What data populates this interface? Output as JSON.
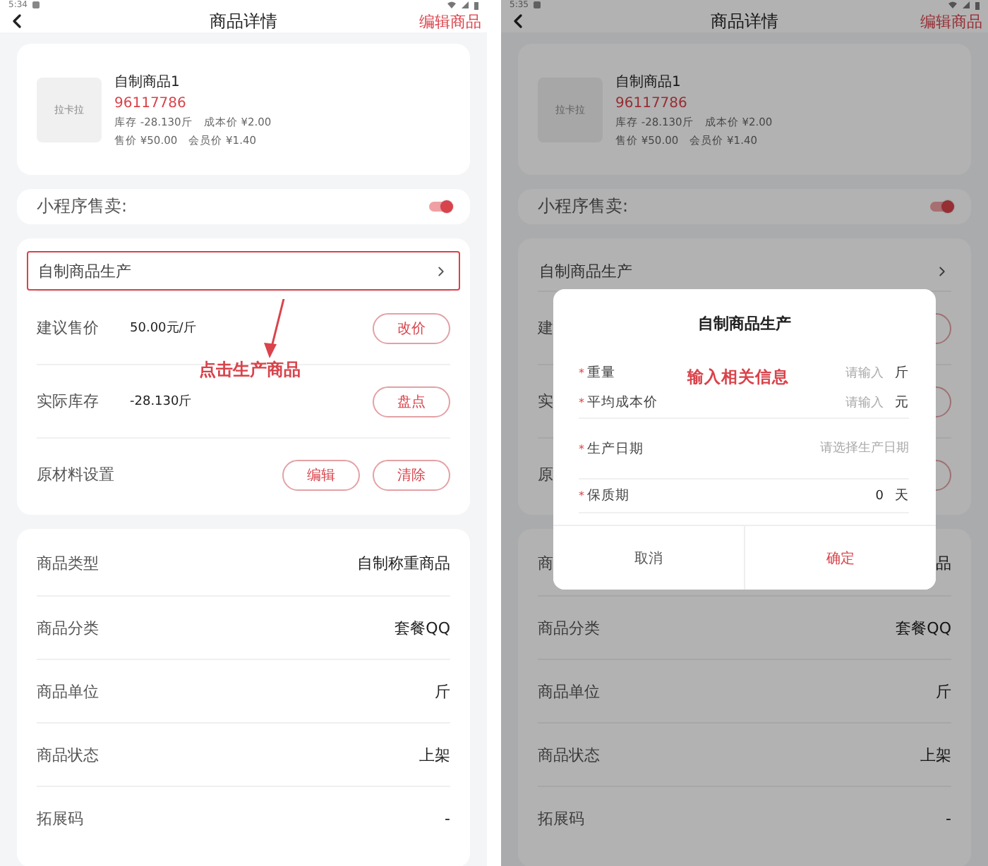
{
  "screens": [
    {
      "status_time": "5:34",
      "title": "商品详情",
      "edit_link": "编辑商品",
      "product": {
        "image_text": "拉卡拉",
        "name": "自制商品1",
        "code": "96117786",
        "info_lines": [
          [
            "库存 -28.130斤",
            "成本价 ¥2.00"
          ],
          [
            "售价 ¥50.00",
            "会员价 ¥1.40"
          ]
        ]
      },
      "mini_program": {
        "label": "小程序售卖:",
        "on": true
      },
      "production": {
        "label": "自制商品生产",
        "highlighted": true
      },
      "settings": [
        {
          "label": "建议售价",
          "value": "50.00元/斤",
          "buttons": [
            {
              "label": "改价"
            }
          ]
        },
        {
          "label": "实际库存",
          "value": "-28.130斤",
          "buttons": [
            {
              "label": "盘点"
            }
          ]
        },
        {
          "label": "原材料设置",
          "buttons": [
            {
              "label": "编辑"
            },
            {
              "label": "清除"
            }
          ]
        }
      ],
      "annotation": "点击生产商品",
      "details": [
        {
          "label": "商品类型",
          "value": "自制称重商品"
        },
        {
          "label": "商品分类",
          "value": "套餐QQ"
        },
        {
          "label": "商品单位",
          "value": "斤"
        },
        {
          "label": "商品状态",
          "value": "上架"
        },
        {
          "label": "拓展码",
          "value": "-"
        }
      ]
    },
    {
      "status_time": "5:35",
      "title": "商品详情",
      "edit_link": "编辑商品",
      "product": {
        "image_text": "拉卡拉",
        "name": "自制商品1",
        "code": "96117786",
        "info_lines": [
          [
            "库存 -28.130斤",
            "成本价 ¥2.00"
          ],
          [
            "售价 ¥50.00",
            "会员价 ¥1.40"
          ]
        ]
      },
      "mini_program": {
        "label": "小程序售卖:",
        "on": true
      },
      "production": {
        "label": "自制商品生产",
        "highlighted": false
      },
      "settings": [
        {
          "label": "建",
          "button_edge": true
        },
        {
          "label": "实",
          "button_edge": true
        },
        {
          "label": "原",
          "button_edge": true
        }
      ],
      "details": [
        {
          "label": "商",
          "value": "品"
        },
        {
          "label": "商品分类",
          "value": "套餐QQ"
        },
        {
          "label": "商品单位",
          "value": "斤"
        },
        {
          "label": "商品状态",
          "value": "上架"
        },
        {
          "label": "拓展码",
          "value": "-"
        }
      ],
      "dialog": {
        "title": "自制商品生产",
        "annotation": "输入相关信息",
        "fields": [
          {
            "required_mark": "*",
            "label": "重量",
            "placeholder": "请输入",
            "unit": "斤"
          },
          {
            "required_mark": "*",
            "label": "平均成本价",
            "placeholder": "请输入",
            "unit": "元"
          },
          {
            "required_mark": "*",
            "label": "生产日期",
            "placeholder": "请选择生产日期"
          },
          {
            "required_mark": "*",
            "label": "保质期",
            "value": "0",
            "unit": "天"
          }
        ],
        "cancel": "取消",
        "confirm": "确定"
      }
    }
  ]
}
